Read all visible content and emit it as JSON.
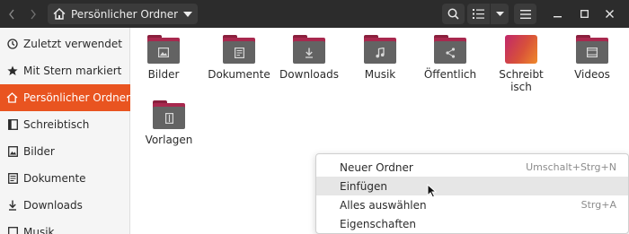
{
  "header": {
    "path_label": "Persönlicher Ordner"
  },
  "sidebar": {
    "items": [
      {
        "label": "Zuletzt verwendet",
        "icon": "clock-icon"
      },
      {
        "label": "Mit Stern markiert",
        "icon": "star-icon"
      },
      {
        "label": "Persönlicher Ordner",
        "icon": "home-icon",
        "active": true
      },
      {
        "label": "Schreibtisch",
        "icon": "desktop-icon"
      },
      {
        "label": "Bilder",
        "icon": "image-icon"
      },
      {
        "label": "Dokumente",
        "icon": "document-icon"
      },
      {
        "label": "Downloads",
        "icon": "download-icon"
      },
      {
        "label": "Musik",
        "icon": "music-icon"
      }
    ]
  },
  "files": [
    {
      "name": "Bilder",
      "icon": "image-folder-icon"
    },
    {
      "name": "Dokumente",
      "icon": "document-folder-icon"
    },
    {
      "name": "Downloads",
      "icon": "download-folder-icon"
    },
    {
      "name": "Musik",
      "icon": "music-folder-icon"
    },
    {
      "name": "Öffentlich",
      "icon": "share-folder-icon"
    },
    {
      "name": "Schreibtisch",
      "icon": "desktop-folder-icon"
    },
    {
      "name": "Videos",
      "icon": "video-folder-icon"
    },
    {
      "name": "Vorlagen",
      "icon": "template-folder-icon"
    }
  ],
  "context_menu": {
    "items": [
      {
        "label": "Neuer Ordner",
        "shortcut": "Umschalt+Strg+N"
      },
      {
        "label": "Einfügen",
        "shortcut": ""
      },
      {
        "label": "Alles auswählen",
        "shortcut": "Strg+A"
      },
      {
        "label": "Eigenschaften",
        "shortcut": ""
      }
    ]
  },
  "colors": {
    "header_bg": "#2c2c2c",
    "accent": "#e95420",
    "folder_front": "#636363",
    "folder_tab": "#a8284e"
  }
}
